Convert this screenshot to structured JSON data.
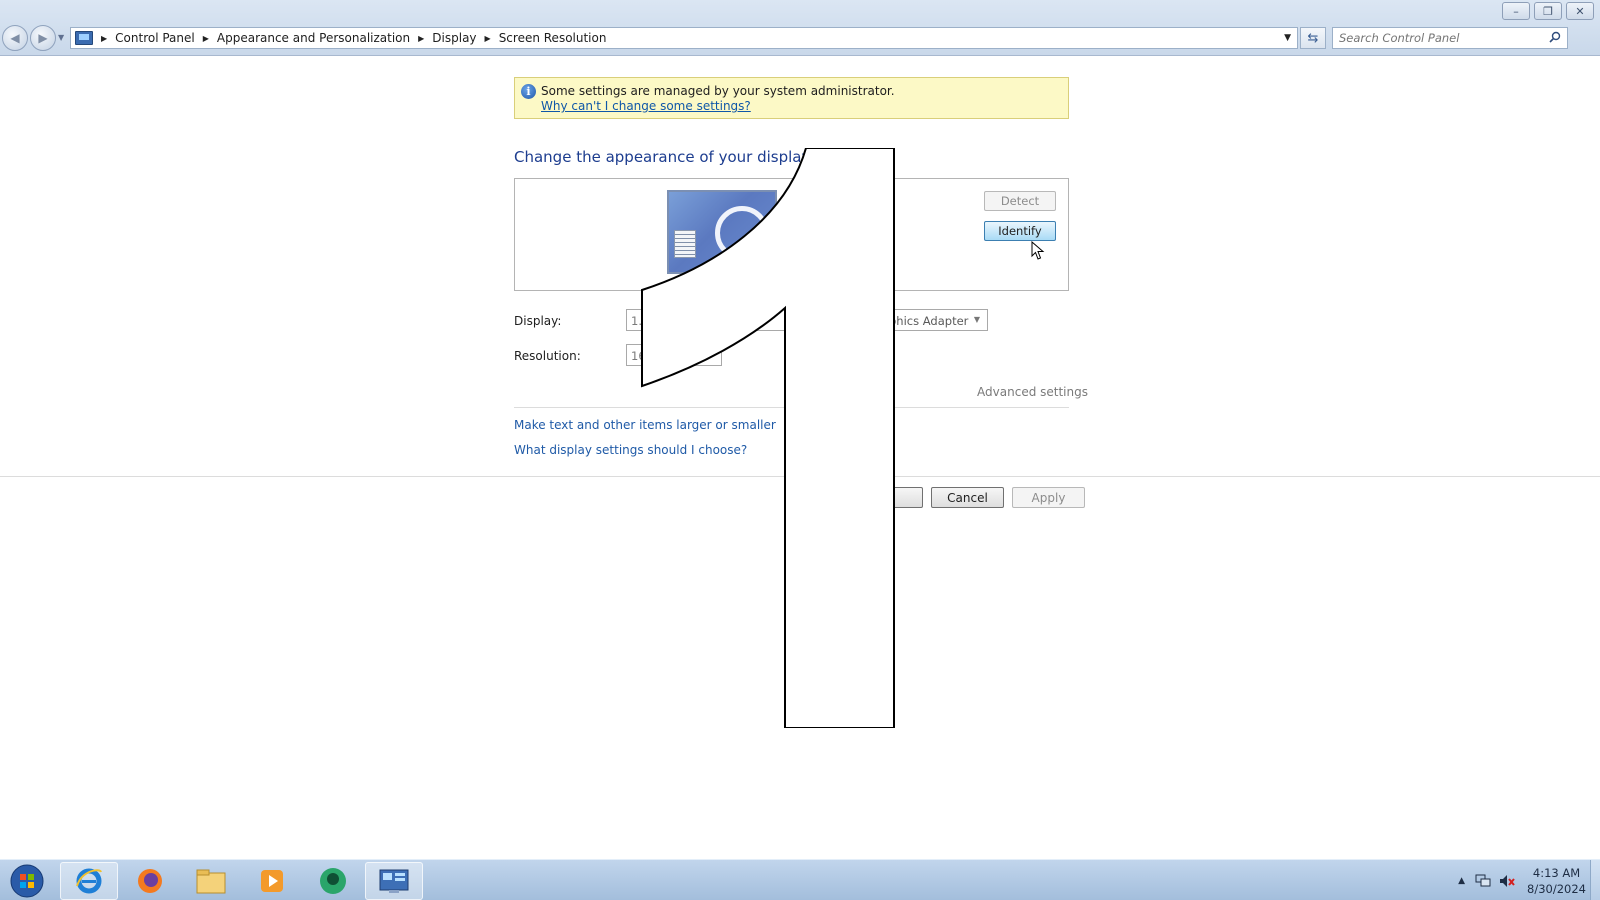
{
  "window": {
    "controls": {
      "minimize": "–",
      "restore": "❐",
      "close": "✕"
    }
  },
  "nav": {
    "back": "◀",
    "forward": "▶"
  },
  "breadcrumb": {
    "items": [
      "Control Panel",
      "Appearance and Personalization",
      "Display",
      "Screen Resolution"
    ]
  },
  "search": {
    "placeholder": "Search Control Panel"
  },
  "info_bar": {
    "text": "Some settings are managed by your system administrator.",
    "link": "Why can't I change some settings?"
  },
  "main": {
    "heading": "Change the appearance of your display",
    "detect_label": "Detect",
    "identify_label": "Identify",
    "display_label": "Display:",
    "display_value_visible_start": "1.",
    "display_value_visible_end": "phics Adapter",
    "resolution_label": "Resolution:",
    "resolution_value_visible_start": "16",
    "advanced_link": "Advanced settings",
    "link_text_size": "Make text and other items larger or smaller",
    "link_display_help": "What display settings should I choose?"
  },
  "buttons": {
    "ok_visible": "K",
    "cancel": "Cancel",
    "apply": "Apply"
  },
  "identify_overlay": {
    "digit": "1"
  },
  "taskbar": {
    "apps": [
      "internet-explorer",
      "firefox",
      "file-explorer",
      "media-player",
      "browser-app",
      "control-panel"
    ]
  },
  "clock": {
    "time": "4:13 AM",
    "date": "8/30/2024"
  },
  "colors": {
    "heading": "#1d3d8f",
    "link": "#1f5aa7",
    "info_bar_bg": "#fcf9c6",
    "taskbar": "#a3bedc"
  }
}
